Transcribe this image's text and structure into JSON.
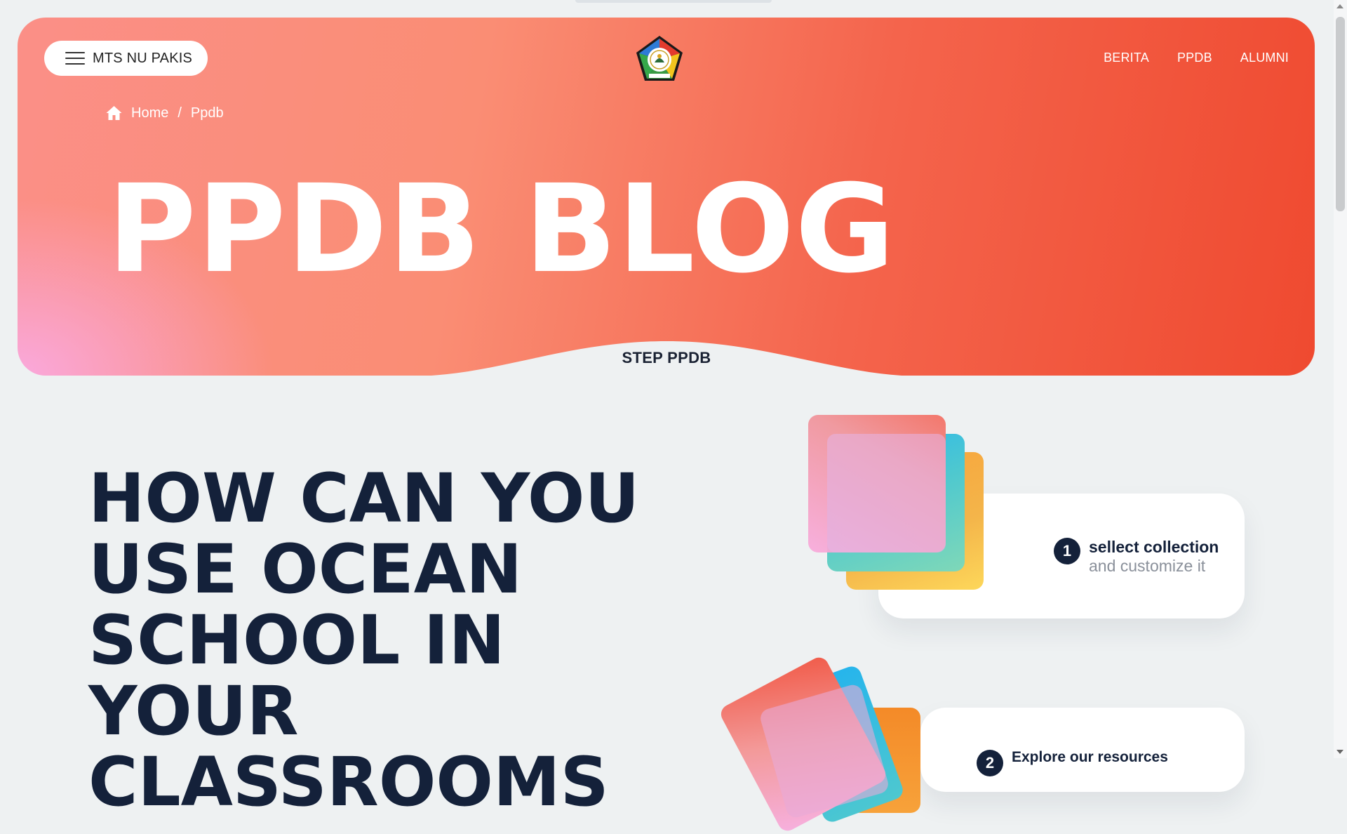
{
  "header": {
    "menu_label": "MTS NU PAKIS",
    "logo_icon": "school-crest-logo",
    "nav": [
      {
        "label": "BERITA"
      },
      {
        "label": "PPDB"
      },
      {
        "label": "ALUMNI"
      }
    ]
  },
  "breadcrumb": {
    "home_icon": "home-icon",
    "home": "Home",
    "separator": "/",
    "current": "Ppdb"
  },
  "hero": {
    "title": "PPDB BLOG",
    "step_label": "STEP PPDB"
  },
  "main": {
    "heading": "HOW CAN YOU USE OCEAN SCHOOL IN YOUR CLASSROOMS"
  },
  "steps": [
    {
      "number": "1",
      "title": "sellect collection",
      "subtitle": "and customize it"
    },
    {
      "number": "2",
      "title": "Explore our resources"
    }
  ],
  "colors": {
    "hero_gradient_start": "#fb8f87",
    "hero_gradient_end": "#ef4a30",
    "hero_pink_glow": "#faaae1",
    "text_dark": "#14213a",
    "page_bg": "#eef1f2"
  }
}
